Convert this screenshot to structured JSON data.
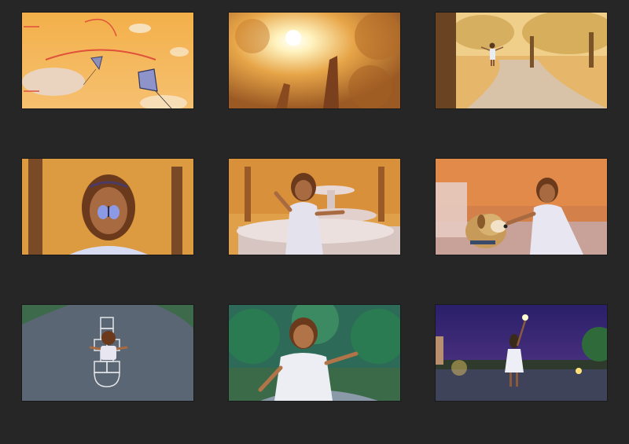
{
  "storyboard": {
    "background": "#262626",
    "panels": [
      {
        "id": 1,
        "scene": "kites-in-sky",
        "palette": "warm-orange"
      },
      {
        "id": 2,
        "scene": "sunlight-through-trees",
        "palette": "golden"
      },
      {
        "id": 3,
        "scene": "girl-on-park-path",
        "palette": "golden"
      },
      {
        "id": 4,
        "scene": "girl-with-butterfly-on-nose",
        "palette": "autumn"
      },
      {
        "id": 5,
        "scene": "girl-at-fountain",
        "palette": "autumn"
      },
      {
        "id": 6,
        "scene": "girl-petting-dog",
        "palette": "autumn"
      },
      {
        "id": 7,
        "scene": "hopscotch-top-view",
        "palette": "slate-blue"
      },
      {
        "id": 8,
        "scene": "girl-in-green-park",
        "palette": "teal-green"
      },
      {
        "id": 9,
        "scene": "girl-with-firefly-at-night",
        "palette": "night-purple"
      }
    ]
  }
}
